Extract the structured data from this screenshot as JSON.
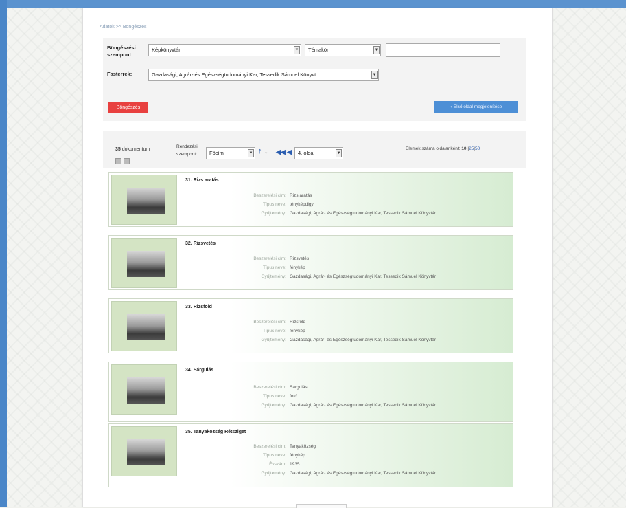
{
  "breadcrumb": "Adatok >> Böngészés",
  "search": {
    "browse_label": "Böngészési szempont:",
    "collection_label": "Fasterrek:",
    "browse_value": "Képkönyvtár",
    "sub_value": "Témakör",
    "collection_value": "Gazdasági, Agrár- és Egészségtudományi Kar, Tessedik Sámuel Könyvt",
    "text_value": "",
    "red_button": "Böngészés",
    "blue_button": "Első oldal megjelenítése"
  },
  "toolbar": {
    "count": "35",
    "count_suffix": "dokumentum",
    "sort_label_1": "Rendezési",
    "sort_label_2": "szempont:",
    "sort_value": "Főcím",
    "page_value": "4. oldal",
    "per_page_label": "Elemek száma oldalanként:",
    "per_page_active": "10",
    "per_page_25": "25",
    "per_page_50": "50"
  },
  "labels": {
    "title": "Beszerelési cím:",
    "type": "Típus neve:",
    "year": "Évszám:",
    "owner": "Gyűjtemény:"
  },
  "results": [
    {
      "number": "31.",
      "title": "Rizs aratás",
      "desc": "Rizs aratás",
      "type": "tényképdigy",
      "owner": "Gazdasági, Agrár- és Egészségtudományi Kar, Tessedik Sámuel Könyvtár"
    },
    {
      "number": "32.",
      "title": "Rizsvetés",
      "desc": "Rizsvetés",
      "type": "fénykép",
      "owner": "Gazdasági, Agrár- és Egészségtudományi Kar, Tessedik Sámuel Könyvtár"
    },
    {
      "number": "33.",
      "title": "Rizsföld",
      "desc": "Rizsföld",
      "type": "fénykép",
      "owner": "Gazdasági, Agrár- és Egészségtudományi Kar, Tessedik Sámuel Könyvtár"
    },
    {
      "number": "34.",
      "title": "Sárgulás",
      "desc": "Sárgulás",
      "type": "fotó",
      "owner": "Gazdasági, Agrár- és Egészségtudományi Kar, Tessedik Sámuel Könyvtár"
    },
    {
      "number": "35.",
      "title": "Tanyaközség Rétsziget",
      "desc": "Tanyaközség",
      "type": "fénykép",
      "year": "1935",
      "owner": "Gazdasági, Agrár- és Egészségtudományi Kar, Tessedik Sámuel Könyvtár"
    }
  ]
}
